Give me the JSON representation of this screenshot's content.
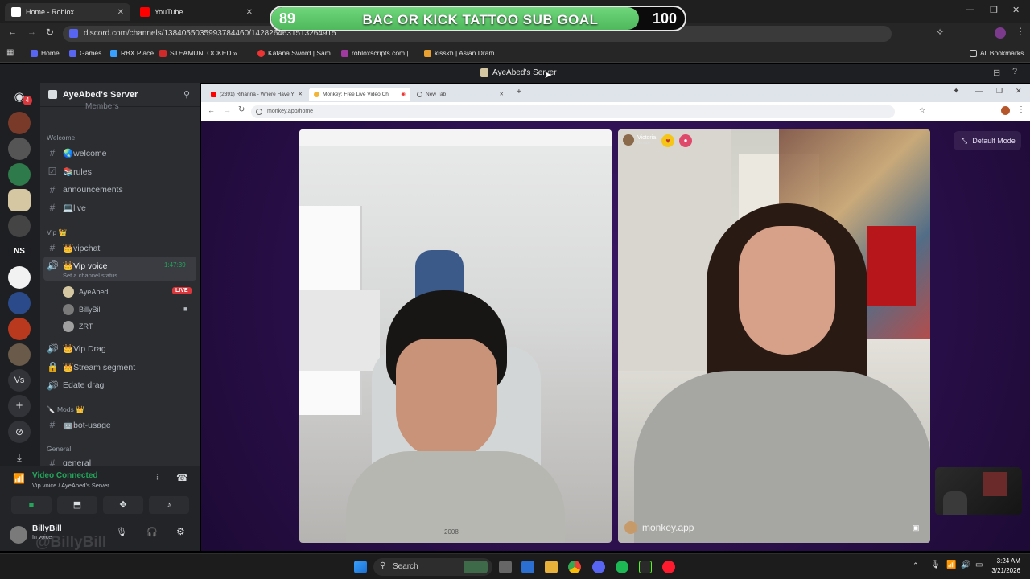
{
  "stream_overlay": {
    "sub_goal_title": "BAC OR KICK TATTOO SUB GOAL",
    "current": "89",
    "goal": "100",
    "progress_fraction": 0.89
  },
  "chrome": {
    "tabs": [
      {
        "label": "Home - Roblox",
        "icon": "roblox-icon"
      },
      {
        "label": "YouTube",
        "icon": "youtube-icon"
      }
    ],
    "url": "discord.com/channels/1384055035993784460/1428264631513264915",
    "bookmarks": [
      "Home",
      "Games",
      "RBX.Place",
      "STEAMUNLOCKED »...",
      "Katana Sword | Sam...",
      "robloxscripts.com |...",
      "kisskh | Asian Dram..."
    ],
    "all_bookmarks": "All Bookmarks"
  },
  "discord": {
    "window_title": "AyeAbed's Server",
    "server_name": "AyeAbed's Server",
    "partial_top_label": "Members",
    "categories": {
      "welcome": "Welcome",
      "vip": "Vip 👑",
      "mods": "🔪 Mods 👑",
      "general": "General"
    },
    "channels": {
      "welcome": "🌏welcome",
      "rules": "📚rules",
      "announcements": "announcements",
      "live": "💻live",
      "vipchat": "👑vipchat",
      "vip_voice": "👑Vip voice",
      "vip_voice_time": "1:47:39",
      "vip_voice_status": "Set a channel status",
      "vip_drag": "👑Vip Drag",
      "stream_segment": "👑Stream segment",
      "edate_drag": "Edate drag",
      "bot_usage": "🤖bot-usage",
      "general": "general"
    },
    "voice_users": [
      {
        "name": "AyeAbed",
        "badge": "LIVE"
      },
      {
        "name": "BillyBill",
        "badge": ""
      },
      {
        "name": "ZRT",
        "badge": ""
      }
    ],
    "server_rail_text": {
      "ns": "NS",
      "vs": "Vs",
      "notif": "4"
    },
    "voice_panel": {
      "status": "Video Connected",
      "location": "Vip voice / AyeAbed's Server"
    },
    "user": {
      "name": "BillyBill",
      "sub": "In voice",
      "watermark": "@BillyBill"
    }
  },
  "embedded_browser": {
    "tabs": [
      {
        "label": "(2391) Rihanna - Where Have Y"
      },
      {
        "label": "Monkey: Free Live Video Ch"
      },
      {
        "label": "New Tab"
      }
    ],
    "url": "monkey.app/home",
    "default_mode": "Default Mode",
    "remote_user": "Victoria",
    "remote_user_sub": "Bronze",
    "watermark": "monkey.app",
    "shirt_text": "2008"
  },
  "taskbar": {
    "search_placeholder": "Search",
    "time": "3:24 AM",
    "date": "3/21/2026"
  },
  "colors": {
    "goal_fill": "#6fd67b",
    "discord_bg": "#2b2d31",
    "monkey_bg": "#2a0f4a",
    "live_badge": "#da373c",
    "voice_connected": "#23a55a"
  }
}
